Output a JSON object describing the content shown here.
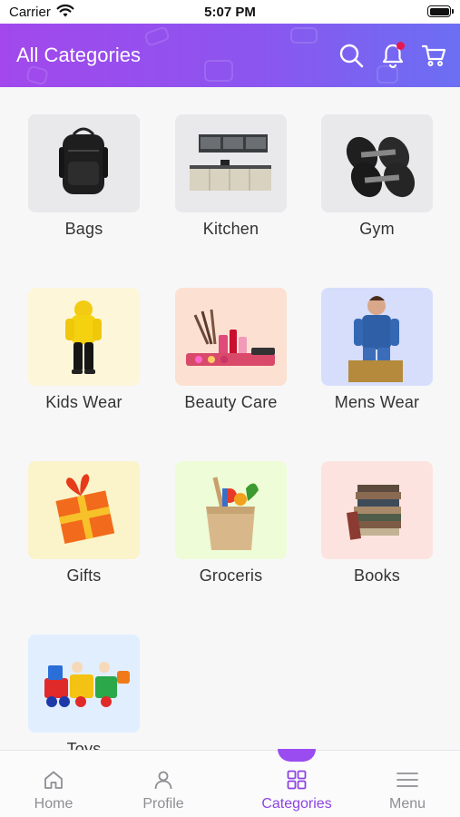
{
  "status_bar": {
    "carrier": "Carrier",
    "time": "5:07 PM",
    "icons": [
      "wifi-icon",
      "battery-icon"
    ]
  },
  "header": {
    "title": "All Categories",
    "actions": [
      {
        "name": "search",
        "icon": "search-icon"
      },
      {
        "name": "notifications",
        "icon": "bell-icon",
        "has_badge": true
      },
      {
        "name": "cart",
        "icon": "cart-icon"
      }
    ],
    "accent_colors": [
      "#a248ec",
      "#6b6ff3"
    ]
  },
  "categories": [
    {
      "label": "Bags",
      "thumb_bg": "#e9e9eb",
      "icon": "backpack-icon"
    },
    {
      "label": "Kitchen",
      "thumb_bg": "#e9e9eb",
      "icon": "kitchen-icon"
    },
    {
      "label": "Gym",
      "thumb_bg": "#e9e9eb",
      "icon": "dumbbell-icon"
    },
    {
      "label": "Kids Wear",
      "thumb_bg": "#fdf6d9",
      "icon": "kids-wear-icon"
    },
    {
      "label": "Beauty Care",
      "thumb_bg": "#fce1d3",
      "icon": "cosmetics-icon"
    },
    {
      "label": "Mens Wear",
      "thumb_bg": "#d6defb",
      "icon": "mens-wear-icon"
    },
    {
      "label": "Gifts",
      "thumb_bg": "#fbf3c9",
      "icon": "gift-icon"
    },
    {
      "label": "Groceris",
      "thumb_bg": "#eefcd7",
      "icon": "grocery-bag-icon"
    },
    {
      "label": "Books",
      "thumb_bg": "#fde3df",
      "icon": "books-icon"
    },
    {
      "label": "Toys",
      "thumb_bg": "#e1eefd",
      "icon": "toy-train-icon"
    }
  ],
  "tabbar": {
    "active_color": "#8d44e3",
    "inactive_color": "#8e8e93",
    "items": [
      {
        "label": "Home",
        "icon": "home-icon",
        "active": false
      },
      {
        "label": "Profile",
        "icon": "profile-icon",
        "active": false
      },
      {
        "label": "Categories",
        "icon": "grid-icon",
        "active": true
      },
      {
        "label": "Menu",
        "icon": "menu-icon",
        "active": false
      }
    ]
  }
}
